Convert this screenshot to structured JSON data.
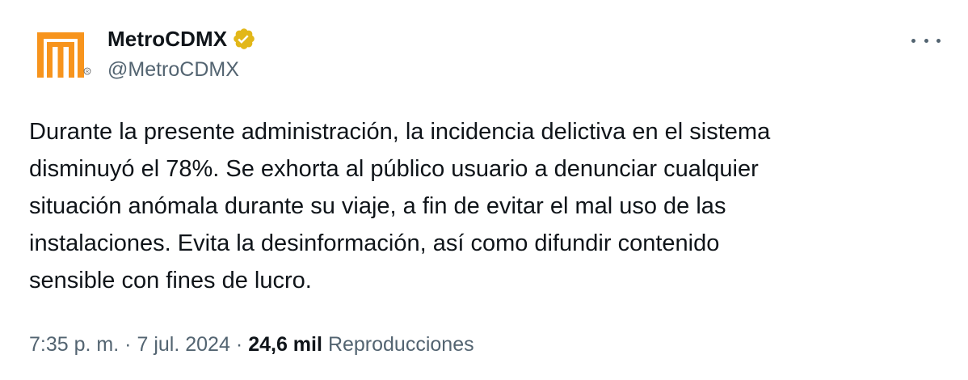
{
  "account": {
    "display_name": "MetroCDMX",
    "handle": "@MetroCDMX",
    "verified": true,
    "verified_color": "#e2b719",
    "avatar_icon": "metro-m-logo",
    "avatar_color": "#f7941d"
  },
  "menu": {
    "more_icon": "ellipsis-icon"
  },
  "tweet": {
    "lines": [
      "Durante la presente administración, la incidencia delictiva en el sistema",
      "disminuyó el 78%. Se exhorta al público usuario a denunciar cualquier",
      "situación anómala durante su viaje, a fin de evitar el mal uso de las",
      "instalaciones. Evita la desinformación, así como difundir contenido",
      "sensible con fines de lucro."
    ]
  },
  "meta": {
    "time": "7:35 p. m.",
    "separator": "·",
    "date": "7 jul. 2024",
    "views_count": "24,6 mil",
    "views_label": "Reproducciones"
  }
}
